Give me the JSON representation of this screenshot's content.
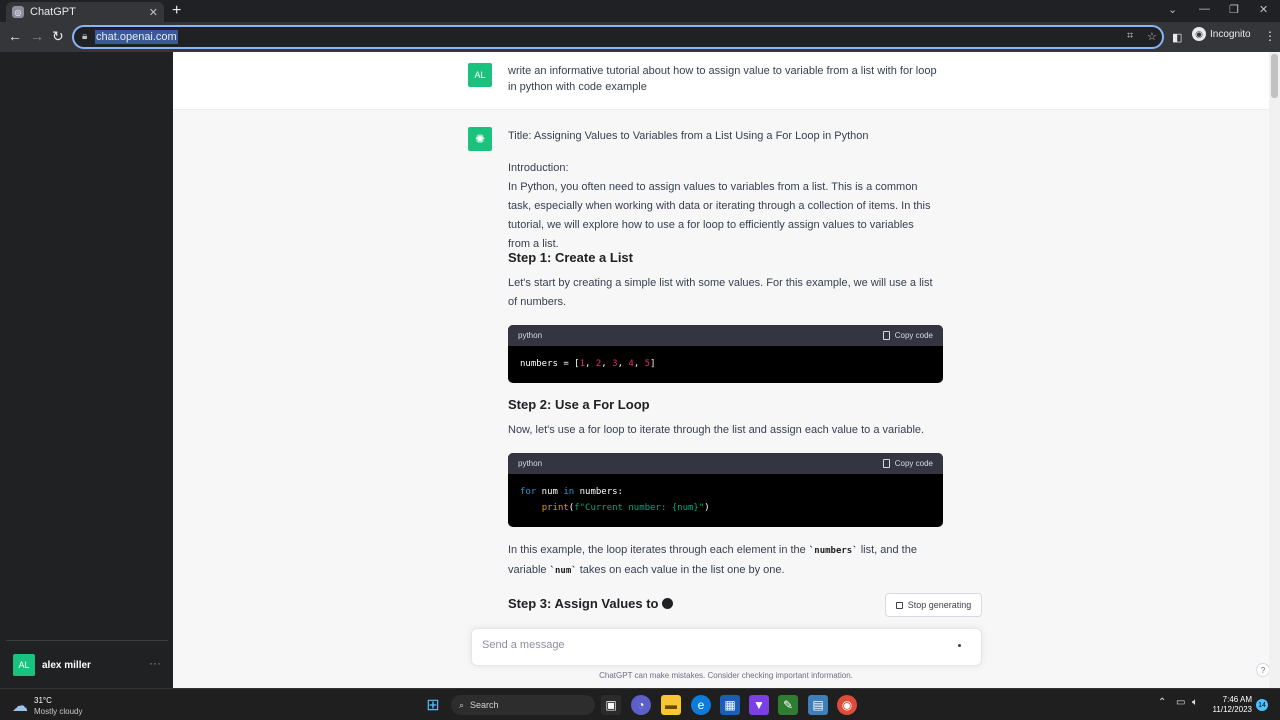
{
  "browser": {
    "tab_title": "ChatGPT",
    "tab_close": "✕",
    "new_tab": "+",
    "url": "chat.openai.com",
    "incognito_label": "Incognito"
  },
  "sidebar": {
    "user_initials": "AL",
    "user_name": "alex miller",
    "more": "···"
  },
  "conversation": {
    "user_initials": "AL",
    "user_message": "write an informative tutorial about how to assign value to variable from a list with for loop in python with code example",
    "title": "Title: Assigning Values to Variables from a List Using a For Loop in Python",
    "intro_heading": "Introduction:",
    "intro_body": "In Python, you often need to assign values to variables from a list. This is a common task, especially when working with data or iterating through a collection of items. In this tutorial, we will explore how to use a for loop to efficiently assign values to variables from a list.",
    "step1_heading": "Step 1: Create a List",
    "step1_body": "Let's start by creating a simple list with some values. For this example, we will use a list of numbers.",
    "code1_lang": "python",
    "code1_copy": "Copy code",
    "code1_line": "numbers = [1, 2, 3, 4, 5]",
    "step2_heading": "Step 2: Use a For Loop",
    "step2_body": "Now, let's use a for loop to iterate through the list and assign each value to a variable.",
    "code2_lang": "python",
    "code2_copy": "Copy code",
    "code2_line1": "for num in numbers:",
    "code2_line2": "    print(f\"Current number: {num}\")",
    "explain_part1": "In this example, the loop iterates through each element in the ",
    "explain_code1": "`numbers`",
    "explain_part2": " list, and the variable ",
    "explain_code2": "`num`",
    "explain_part3": " takes on each value in the list one by one.",
    "step3_heading": "Step 3: Assign Values to"
  },
  "composer": {
    "stop_label": "Stop generating",
    "placeholder": "Send a message",
    "disclaimer": "ChatGPT can make mistakes. Consider checking important information.",
    "help": "?"
  },
  "taskbar": {
    "temperature": "31°C",
    "weather": "Mostly cloudy",
    "search_label": "Search",
    "time": "7:46 AM",
    "date": "11/12/2023",
    "notification_count": "14"
  },
  "colors": {
    "accent_green": "#19c37d",
    "sidebar_bg": "#202123",
    "assistant_bg": "#f7f7f8"
  }
}
